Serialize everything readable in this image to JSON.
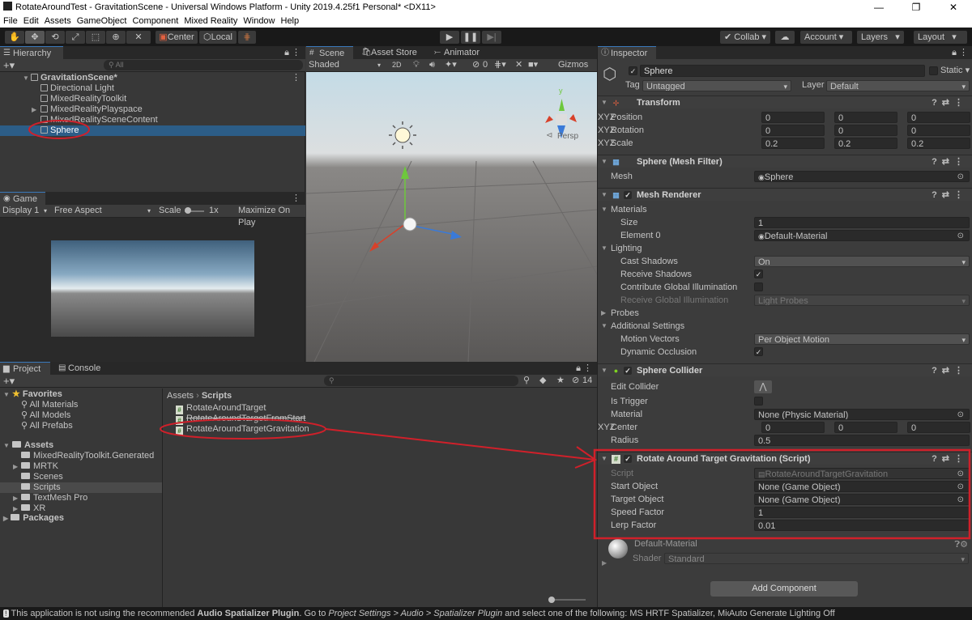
{
  "window": {
    "title": "RotateAroundTest - GravitationScene - Universal Windows Platform - Unity 2019.4.25f1 Personal* <DX11>",
    "controls": [
      "—",
      "❐",
      "✕"
    ]
  },
  "menu": [
    "File",
    "Edit",
    "Assets",
    "GameObject",
    "Component",
    "Mixed Reality",
    "Window",
    "Help"
  ],
  "toolbar": {
    "tools": [
      "hand-tool",
      "move-tool",
      "rotate-tool",
      "scale-tool",
      "rect-tool",
      "transform-tool",
      "custom-tool"
    ],
    "pivot": "Center",
    "space": "Local",
    "collab": "Collab",
    "account": "Account",
    "layers": "Layers",
    "layout": "Layout"
  },
  "hierarchy": {
    "tab": "Hierarchy",
    "search_placeholder": "All",
    "items": [
      {
        "label": "GravitationScene*",
        "type": "scene"
      },
      {
        "label": "Directional Light"
      },
      {
        "label": "MixedRealityToolkit"
      },
      {
        "label": "MixedRealityPlayspace",
        "expandable": true
      },
      {
        "label": "MixedRealitySceneContent"
      },
      {
        "label": "Sphere",
        "selected": true
      }
    ]
  },
  "game": {
    "tab": "Game",
    "display": "Display 1",
    "aspect": "Free Aspect",
    "scale_label": "Scale",
    "scale_value": "1x",
    "maximize": "Maximize On Play"
  },
  "scene": {
    "tabs": [
      "Scene",
      "Asset Store",
      "Animator"
    ],
    "shading": "Shaded",
    "mode2d": "2D",
    "hidden_count": "0",
    "gizmos": "Gizmos",
    "persp": "Persp",
    "axis_y": "y"
  },
  "project": {
    "tabs": [
      "Project",
      "Console"
    ],
    "hidden_count": "14",
    "favorites": {
      "label": "Favorites",
      "items": [
        "All Materials",
        "All Models",
        "All Prefabs"
      ]
    },
    "assets": {
      "label": "Assets",
      "items": [
        {
          "label": "MixedRealityToolkit.Generated"
        },
        {
          "label": "MRTK",
          "expandable": true
        },
        {
          "label": "Scenes"
        },
        {
          "label": "Scripts",
          "selected": true
        },
        {
          "label": "TextMesh Pro",
          "expandable": true
        },
        {
          "label": "XR",
          "expandable": true
        }
      ]
    },
    "packages": "Packages",
    "breadcrumb": [
      "Assets",
      "Scripts"
    ],
    "files": [
      "RotateAroundTarget",
      "RotateAroundTargetFromStart",
      "RotateAroundTargetGravitation"
    ]
  },
  "inspector": {
    "tab": "Inspector",
    "object_name": "Sphere",
    "active": true,
    "static_label": "Static",
    "tag_label": "Tag",
    "tag": "Untagged",
    "layer_label": "Layer",
    "layer": "Default",
    "components": [
      {
        "title": "Transform",
        "icon": "transform-icon",
        "rows": [
          {
            "label": "Position",
            "kind": "vec3",
            "values": [
              "0",
              "0",
              "0"
            ]
          },
          {
            "label": "Rotation",
            "kind": "vec3",
            "values": [
              "0",
              "0",
              "0"
            ]
          },
          {
            "label": "Scale",
            "kind": "vec3",
            "values": [
              "0.2",
              "0.2",
              "0.2"
            ]
          }
        ]
      },
      {
        "title": "Sphere (Mesh Filter)",
        "icon": "mesh-filter-icon",
        "rows": [
          {
            "label": "Mesh",
            "kind": "object",
            "value": "Sphere"
          }
        ]
      },
      {
        "title": "Mesh Renderer",
        "icon": "mesh-renderer-icon",
        "check": true,
        "rows": [
          {
            "label": "Materials",
            "kind": "section"
          },
          {
            "label": "Size",
            "kind": "text",
            "value": "1",
            "indent": true
          },
          {
            "label": "Element 0",
            "kind": "object",
            "value": "Default-Material",
            "indent": true
          },
          {
            "label": "Lighting",
            "kind": "section"
          },
          {
            "label": "Cast Shadows",
            "kind": "dropdown",
            "value": "On",
            "indent": true
          },
          {
            "label": "Receive Shadows",
            "kind": "check",
            "checked": true,
            "indent": true
          },
          {
            "label": "Contribute Global Illumination",
            "kind": "check",
            "checked": false,
            "indent": true
          },
          {
            "label": "Receive Global Illumination",
            "kind": "dropdown",
            "value": "Light Probes",
            "indent": true,
            "disabled": true
          },
          {
            "label": "Probes",
            "kind": "section",
            "collapsed": true
          },
          {
            "label": "Additional Settings",
            "kind": "section"
          },
          {
            "label": "Motion Vectors",
            "kind": "dropdown",
            "value": "Per Object Motion",
            "indent": true
          },
          {
            "label": "Dynamic Occlusion",
            "kind": "check",
            "checked": true,
            "indent": true
          }
        ]
      },
      {
        "title": "Sphere Collider",
        "icon": "sphere-collider-icon",
        "check": true,
        "rows": [
          {
            "label": "Edit Collider",
            "kind": "button"
          },
          {
            "label": "Is Trigger",
            "kind": "check",
            "checked": false
          },
          {
            "label": "Material",
            "kind": "object",
            "value": "None (Physic Material)"
          },
          {
            "label": "Center",
            "kind": "vec3",
            "values": [
              "0",
              "0",
              "0"
            ]
          },
          {
            "label": "Radius",
            "kind": "text",
            "value": "0.5"
          }
        ]
      },
      {
        "title": "Rotate Around Target Gravitation (Script)",
        "icon": "script-icon",
        "check": true,
        "rows": [
          {
            "label": "Script",
            "kind": "object",
            "value": "RotateAroundTargetGravitation",
            "disabled": true
          },
          {
            "label": "Start Object",
            "kind": "object",
            "value": "None (Game Object)"
          },
          {
            "label": "Target Object",
            "kind": "object",
            "value": "None (Game Object)"
          },
          {
            "label": "Speed Factor",
            "kind": "text",
            "value": "1"
          },
          {
            "label": "Lerp Factor",
            "kind": "text",
            "value": "0.01"
          }
        ]
      }
    ],
    "material": {
      "name": "Default-Material",
      "shader_label": "Shader",
      "shader": "Standard"
    },
    "add_component": "Add Component"
  },
  "status": {
    "part1": "This application is not using the recommended ",
    "bold": "Audio Spatializer Plugin",
    "part2": ". Go to ",
    "italic1": "Project Settings > Audio > Spatializer Plugin",
    "part3": " and select one of the following: MS HRTF Spatializer, Microsoft S",
    "lighting": "Auto Generate Lighting Off"
  },
  "colors": {
    "selection": "#2c5d87",
    "annotation": "#d0202a",
    "accent_tab": "#3a79bb"
  }
}
